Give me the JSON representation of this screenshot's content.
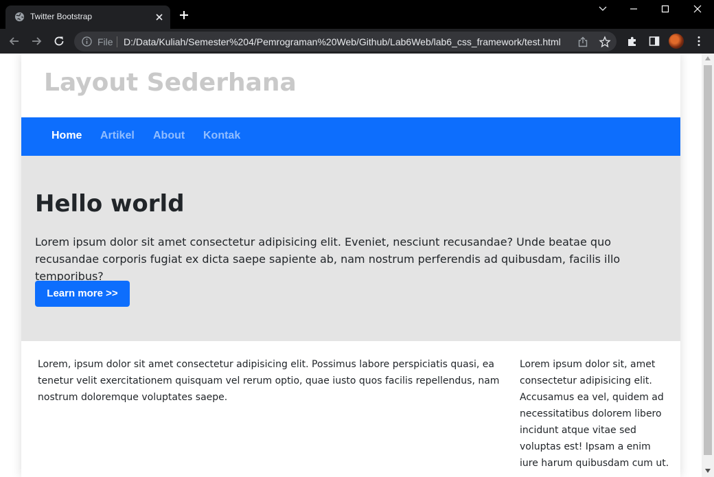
{
  "browser": {
    "tab_title": "Twitter Bootstrap",
    "url_scheme_label": "File",
    "url": "D:/Data/Kuliah/Semester%204/Pemrograman%20Web/Github/Lab6Web/lab6_css_framework/test.html",
    "icons": [
      "globe-icon",
      "close-icon",
      "new-tab-icon",
      "tab-search-icon",
      "minimize-icon",
      "maximize-icon",
      "window-close-icon",
      "back-icon",
      "forward-icon",
      "reload-icon",
      "info-icon",
      "share-icon",
      "bookmark-star-icon",
      "extensions-icon",
      "side-panel-icon",
      "profile-avatar",
      "menu-icon"
    ]
  },
  "page": {
    "site_title": "Layout Sederhana",
    "nav": [
      {
        "label": "Home",
        "active": true
      },
      {
        "label": "Artikel",
        "active": false
      },
      {
        "label": "About",
        "active": false
      },
      {
        "label": "Kontak",
        "active": false
      }
    ],
    "hero": {
      "title": "Hello world",
      "text": "Lorem ipsum dolor sit amet consectetur adipisicing elit. Eveniet, nesciunt recusandae? Unde beatae quo recusandae corporis fugiat ex dicta saepe sapiente ab, nam nostrum perferendis ad quibusdam, facilis illo temporibus?",
      "button_label": "Learn more >>"
    },
    "main_text": "Lorem, ipsum dolor sit amet consectetur adipisicing elit. Possimus labore perspiciatis quasi, ea tenetur velit exercitationem quisquam vel rerum optio, quae iusto quos facilis repellendus, nam nostrum doloremque voluptates saepe.",
    "side_text": "Lorem ipsum dolor sit, amet consectetur adipisicing elit. Accusamus ea vel, quidem ad necessitatibus dolorem libero incidunt atque vitae sed voluptas est! Ipsam a enim iure harum quibusdam cum ut."
  },
  "colors": {
    "primary": "#0d6efd",
    "hero_bg": "#e4e4e4",
    "site_title": "#c9c9c9",
    "chrome_dark": "#202124"
  }
}
